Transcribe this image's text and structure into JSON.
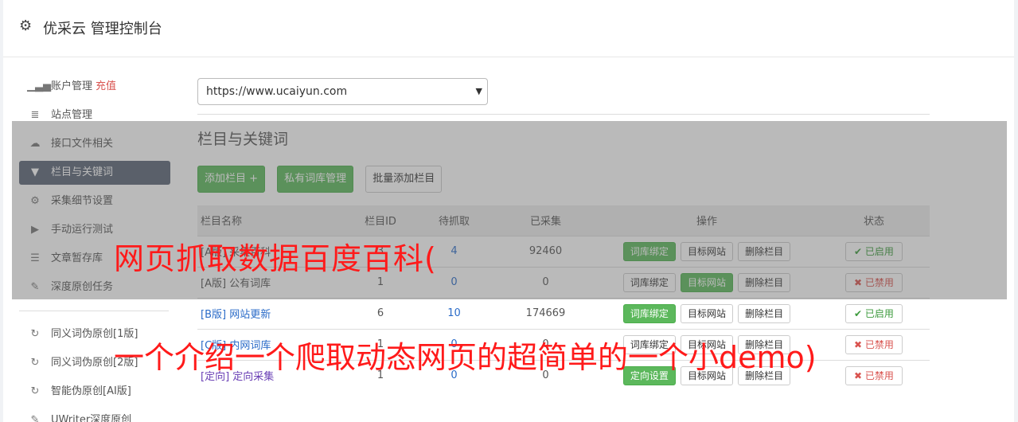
{
  "app": {
    "title": "优采云 管理控制台"
  },
  "sidebar": {
    "items": [
      {
        "label": "账户管理",
        "extra": "充值",
        "icon": "bar-chart-icon"
      },
      {
        "label": "站点管理",
        "icon": "server-icon"
      },
      {
        "label": "接口文件相关",
        "icon": "cloud-upload-icon"
      },
      {
        "label": "栏目与关键词",
        "icon": "filter-icon",
        "active": true
      },
      {
        "label": "采集细节设置",
        "icon": "cogs-icon"
      },
      {
        "label": "手动运行测试",
        "icon": "play-circle-icon"
      },
      {
        "label": "文章暂存库",
        "icon": "database-icon"
      },
      {
        "label": "深度原创任务",
        "icon": "edit-icon"
      }
    ],
    "items2": [
      {
        "label": "同义词伪原创[1版]",
        "icon": "refresh-icon"
      },
      {
        "label": "同义词伪原创[2版]",
        "icon": "refresh-icon"
      },
      {
        "label": "智能伪原创[AI版]",
        "icon": "refresh-icon"
      },
      {
        "label": "UWriter深度原创",
        "icon": "edit-icon"
      }
    ]
  },
  "main": {
    "site_select": "https://www.ucaiyun.com",
    "section_title": "栏目与关键词",
    "buttons": {
      "add": "添加栏目 +",
      "private": "私有词库管理",
      "batch": "批量添加栏目"
    },
    "table": {
      "headers": [
        "栏目名称",
        "栏目ID",
        "待抓取",
        "已采集",
        "操作",
        "状态"
      ],
      "rows": [
        {
          "name": "[A版] 采集百科",
          "id": "3",
          "pending": "4",
          "collected": "92460",
          "op1": "词库绑定",
          "op2": "目标网站",
          "op3": "删除栏目",
          "status": "已启用"
        },
        {
          "name": "[A版] 公有词库",
          "id": "1",
          "pending": "0",
          "collected": "0",
          "op1": "词库绑定",
          "op2": "目标网站",
          "op3": "删除栏目",
          "status": "已禁用"
        },
        {
          "name": "[B版] 网站更新",
          "id": "6",
          "pending": "10",
          "collected": "174669",
          "op1": "词库绑定",
          "op2": "目标网站",
          "op3": "删除栏目",
          "status": "已启用"
        },
        {
          "name": "[C版] 内网词库",
          "id": "1",
          "pending": "0",
          "collected": "0",
          "op1": "词库绑定",
          "op2": "目标网站",
          "op3": "删除栏目",
          "status": "已禁用"
        },
        {
          "name": "[定向] 定向采集",
          "id": "1",
          "pending": "0",
          "collected": "0",
          "op1": "定向设置",
          "op2": "目标网站",
          "op3": "删除栏目",
          "status": "已禁用"
        }
      ]
    }
  },
  "overlay": {
    "line1": "网页抓取数据百度百科(",
    "line2": "一个介绍一个爬取动态网页的超简单的一个小demo)"
  }
}
